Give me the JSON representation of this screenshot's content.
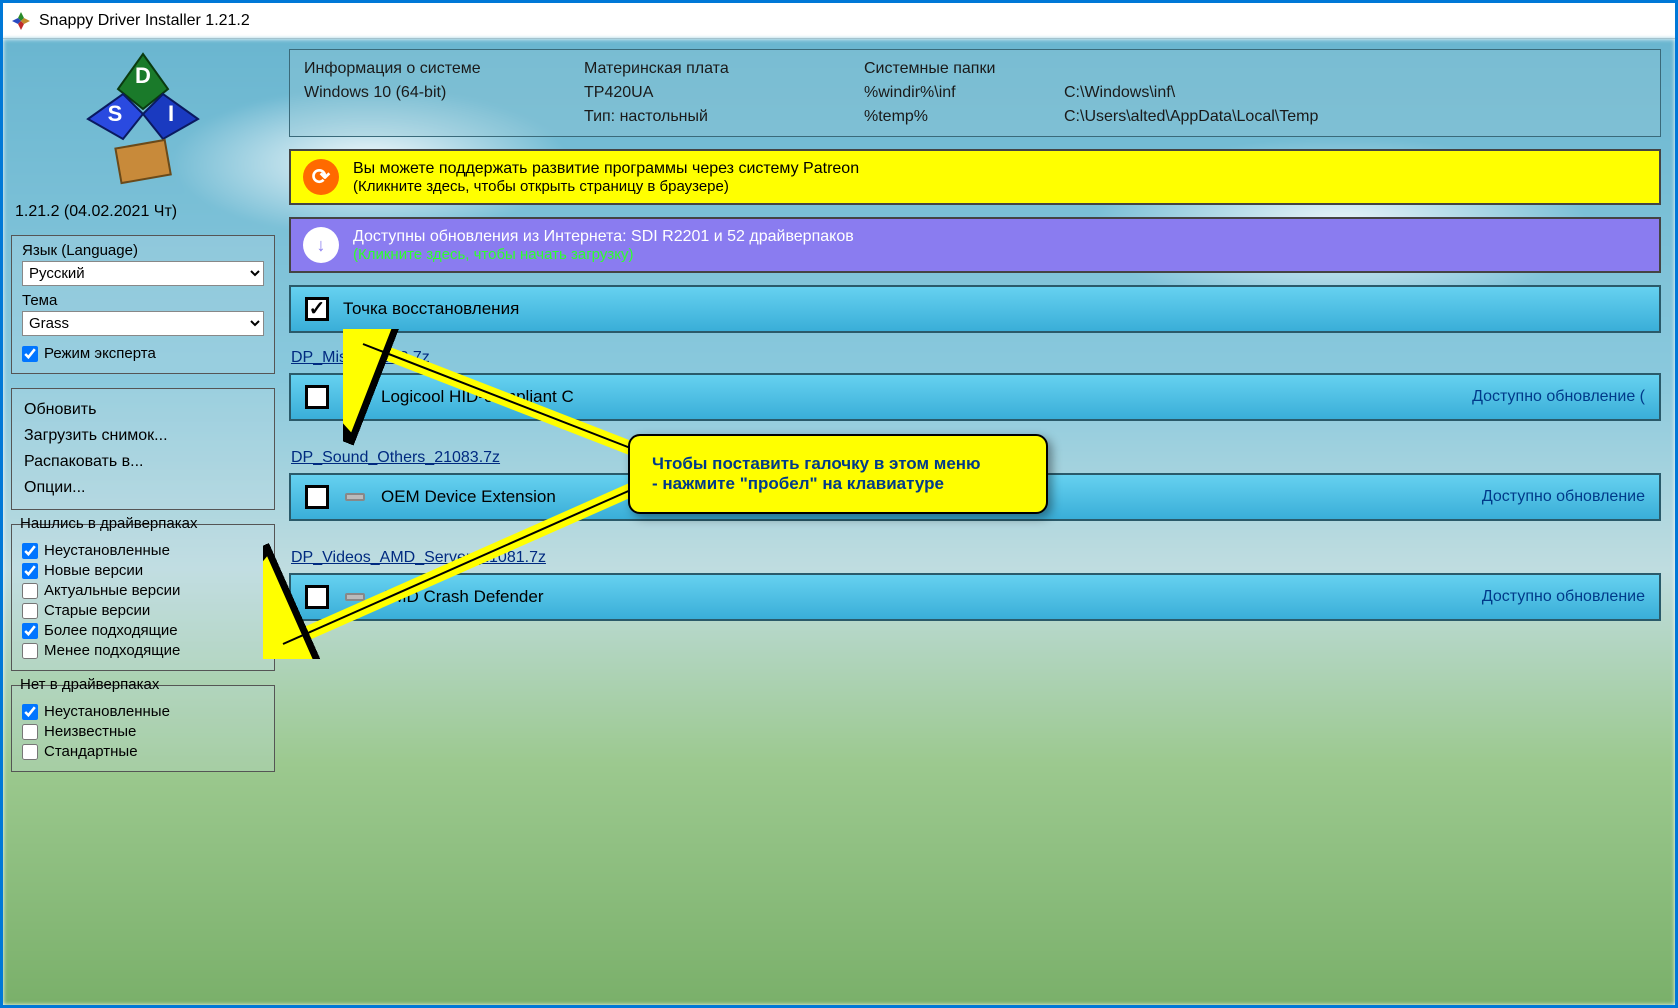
{
  "window": {
    "title": "Snappy Driver Installer 1.21.2"
  },
  "version": "1.21.2 (04.02.2021 Чт)",
  "langPanel": {
    "langLabel": "Язык (Language)",
    "langValue": "Русский",
    "themeLabel": "Тема",
    "themeValue": "Grass",
    "expert": "Режим эксперта"
  },
  "actions": {
    "refresh": "Обновить",
    "loadSnapshot": "Загрузить снимок...",
    "extract": "Распаковать в...",
    "options": "Опции..."
  },
  "found": {
    "legend": "Нашлись в драйверпаках",
    "items": [
      {
        "label": "Неустановленные",
        "checked": true
      },
      {
        "label": "Новые версии",
        "checked": true
      },
      {
        "label": "Актуальные версии",
        "checked": false
      },
      {
        "label": "Старые версии",
        "checked": false
      },
      {
        "label": "Более подходящие",
        "checked": true
      },
      {
        "label": "Менее подходящие",
        "checked": false
      }
    ]
  },
  "notFound": {
    "legend": "Нет в драйверпаках",
    "items": [
      {
        "label": "Неустановленные",
        "checked": true
      },
      {
        "label": "Неизвестные",
        "checked": false
      },
      {
        "label": "Стандартные",
        "checked": false
      }
    ]
  },
  "sysinfo": {
    "h1": "Информация о системе",
    "h2": "Материнская плата",
    "h3": "Системные папки",
    "h4": "",
    "r1c1": "Windows 10 (64-bit)",
    "r1c2": "TP420UA",
    "r1c3": "%windir%\\inf",
    "r1c4": "C:\\Windows\\inf\\",
    "r2c1": "",
    "r2c2": "Тип: настольный",
    "r2c3": "%temp%",
    "r2c4": "C:\\Users\\alted\\AppData\\Local\\Temp"
  },
  "patreon": {
    "line1": "Вы можете поддержать развитие программы через систему Patreon",
    "line2": "(Кликните здесь, чтобы открыть страницу в браузере)"
  },
  "updates": {
    "line1": "Доступны обновления из Интернета: SDI R2201 и 52 драйверпаков",
    "line2": "(Кликните здесь, чтобы начать загрузку)"
  },
  "restore": {
    "label": "Точка восстановления"
  },
  "groups": [
    {
      "title": "DP_Misc_21083.7z",
      "rows": [
        {
          "name": "Logicool HID-compliant C",
          "status": "Доступно обновление ("
        }
      ]
    },
    {
      "title": "DP_Sound_Others_21083.7z",
      "rows": [
        {
          "name": "OEM Device Extension",
          "status": "Доступно обновление"
        }
      ]
    },
    {
      "title": "DP_Videos_AMD_Server_21081.7z",
      "rows": [
        {
          "name": "AMD Crash Defender",
          "status": "Доступно обновление"
        }
      ]
    }
  ],
  "callout": {
    "line1": "Чтобы поставить галочку в этом меню",
    "line2": "- нажмите \"пробел\" на клавиатуре"
  }
}
